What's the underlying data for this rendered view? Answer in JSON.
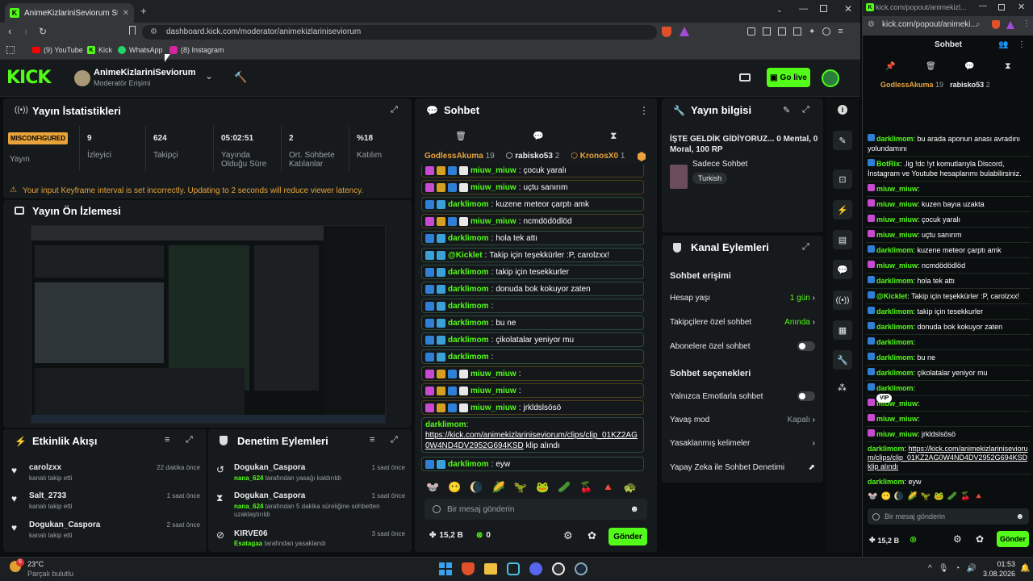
{
  "browser": {
    "tab_title": "AnimeKizlariniSeviorum Stream",
    "url": "dashboard.kick.com/moderator/animekizlariniseviorum",
    "bookmarks": [
      "(9) YouTube",
      "Kick",
      "WhatsApp",
      "(8) Instagram"
    ]
  },
  "header": {
    "channel": "AnimeKizlariniSeviorum",
    "role": "Moderatör Erişimi",
    "go_live": "Go live"
  },
  "stats": {
    "title": "Yayın İstatistikleri",
    "status": "MISCONFIGURED",
    "status_label": "Yayın",
    "items": [
      {
        "value": "9",
        "label": "İzleyici"
      },
      {
        "value": "624",
        "label": "Takipçi"
      },
      {
        "value": "05:02:51",
        "label": "Yayında Olduğu Süre"
      },
      {
        "value": "2",
        "label": "Ort. Sohbete Katılanlar"
      },
      {
        "value": "%18",
        "label": "Katılım"
      }
    ],
    "warning": "Your input Keyframe interval is set incorrectly. Updating to 2 seconds will reduce viewer latency."
  },
  "preview": {
    "title": "Yayın Ön İzlemesi"
  },
  "activity": {
    "title": "Etkinlik Akışı",
    "items": [
      {
        "user": "carolzxx",
        "desc": "kanalı takip etti",
        "time": "22 dakika önce"
      },
      {
        "user": "Salt_2733",
        "desc": "kanalı takip etti",
        "time": "1 saat önce"
      },
      {
        "user": "Dogukan_Caspora",
        "desc": "kanalı takip etti",
        "time": "2 saat önce"
      }
    ]
  },
  "moderation": {
    "title": "Denetim Eylemleri",
    "items": [
      {
        "user": "Dogukan_Caspora",
        "actor": "nana_624",
        "desc": "tarafından yasağı kaldırıldı",
        "time": "1 saat önce"
      },
      {
        "user": "Dogukan_Caspora",
        "actor": "nana_624",
        "desc": "tarafından 5 dakika süreliğine sohbetten uzaklaştırıldı",
        "time": "1 saat önce"
      },
      {
        "user": "KIRVE06",
        "actor": "Esatagaa",
        "desc": "tarafından yasaklandı",
        "time": "3 saat önce"
      }
    ]
  },
  "chat": {
    "title": "Sohbet",
    "placeholder": "Bir mesaj gönderin",
    "send": "Gönder",
    "kicks": "15,2 B",
    "points": "0",
    "gifters": [
      {
        "name": "GodlessAkuma",
        "count": "19"
      },
      {
        "name": "rabisko53",
        "count": "2"
      },
      {
        "name": "KronosX0",
        "count": "1"
      }
    ],
    "messages": [
      {
        "user": "miuw_miuw",
        "color": "#53fc18",
        "text": "çocuk yaralı",
        "badges": "s"
      },
      {
        "user": "miuw_miuw",
        "color": "#53fc18",
        "text": "uçtu sanırım",
        "badges": "s"
      },
      {
        "user": "darklimom",
        "color": "#53fc18",
        "text": "kuzene meteor çarptı amk",
        "badges": "m"
      },
      {
        "user": "miuw_miuw",
        "color": "#53fc18",
        "text": "ncmdödödlöd",
        "badges": "s"
      },
      {
        "user": "darklimom",
        "color": "#53fc18",
        "text": "hola tek attı",
        "badges": "m"
      },
      {
        "user": "@Kicklet",
        "color": "#53fc18",
        "text": "Takip için teşekkürler :P, carolzxx!",
        "badges": "b"
      },
      {
        "user": "darklimom",
        "color": "#53fc18",
        "text": "takip için tesekkurler",
        "badges": "m"
      },
      {
        "user": "darklimom",
        "color": "#53fc18",
        "text": "donuda bok kokuyor zaten",
        "badges": "m"
      },
      {
        "user": "darklimom",
        "color": "#53fc18",
        "text": "",
        "badges": "m"
      },
      {
        "user": "darklimom",
        "color": "#53fc18",
        "text": "bu ne",
        "badges": "m"
      },
      {
        "user": "darklimom",
        "color": "#53fc18",
        "text": "çikolatalar yeniyor mu",
        "badges": "m"
      },
      {
        "user": "darklimom",
        "color": "#53fc18",
        "text": "",
        "badges": "m"
      },
      {
        "user": "miuw_miuw",
        "color": "#53fc18",
        "text": "",
        "badges": "s"
      },
      {
        "user": "miuw_miuw",
        "color": "#53fc18",
        "text": "",
        "badges": "s"
      },
      {
        "user": "miuw_miuw",
        "color": "#53fc18",
        "text": "jrkldslsösö",
        "badges": "s"
      }
    ],
    "link_user": "darklimom",
    "link_url": "https://kick.com/animekizlariniseviorum/clips/clip_01KZ2AG0W4ND4DV2952G694KSD",
    "link_suffix": "klip alındı",
    "last": {
      "user": "darklimom",
      "text": "eyw"
    }
  },
  "info": {
    "title": "Yayın bilgisi",
    "stream_title": "İŞTE GELDİK GİDİYORUZ... 0 Mental, 0 Moral, 100 RP",
    "category": "Sadece Sohbet",
    "tag": "Turkish"
  },
  "actions": {
    "title": "Kanal Eylemleri",
    "chat_access": "Sohbet erişimi",
    "rows": [
      {
        "label": "Hesap yaşı",
        "value": "1 gün"
      },
      {
        "label": "Takipçilere özel sohbet",
        "value": "Anında"
      },
      {
        "label": "Abonelere özel sohbet",
        "value": ""
      }
    ],
    "chat_options": "Sohbet seçenekleri",
    "rows2": [
      {
        "label": "Yalnızca Emotlarla sohbet",
        "value": ""
      },
      {
        "label": "Yavaş mod",
        "value": "Kapalı"
      },
      {
        "label": "Yasaklanmış kelimeler",
        "value": ""
      },
      {
        "label": "Yapay Zeka ile Sohbet Denetimi",
        "value": ""
      }
    ]
  },
  "popout": {
    "url": "kick.com/popout/animeki...",
    "url_short": "kick.com/popout/animekizl...",
    "title": "Sohbet",
    "placeholder": "Bir mesaj gönderin",
    "send": "Gönder",
    "kicks": "15,2 B",
    "gifters": [
      {
        "name": "GodlessAkuma",
        "count": "19"
      },
      {
        "name": "rabisko53",
        "count": "2"
      }
    ],
    "messages": [
      {
        "user": "darklimom",
        "text": "bu arada aponun anası avradını yolundamını"
      },
      {
        "user": "BotRix",
        "text": ".lig !dc !yt komutlarıyla Discord, İnstagram ve Youtube hesaplarımı bulabilirsiniz."
      },
      {
        "user": "miuw_miuw",
        "text": ""
      },
      {
        "user": "miuw_miuw",
        "text": "kuzen bayıa uzakta"
      },
      {
        "user": "miuw_miuw",
        "text": "çocuk yaralı"
      },
      {
        "user": "miuw_miuw",
        "text": "uçtu sanırım"
      },
      {
        "user": "darklimom",
        "text": "kuzene meteor çarptı amk"
      },
      {
        "user": "miuw_miuw",
        "text": "ncmdödödlöd"
      },
      {
        "user": "darklimom",
        "text": "hola tek attı"
      },
      {
        "user": "@Kicklet",
        "text": "Takip için teşekkürler :P, carolzxx!"
      },
      {
        "user": "darklimom",
        "text": "takip için tesekkurler"
      },
      {
        "user": "darklimom",
        "text": "donuda bok kokuyor zaten"
      },
      {
        "user": "darklimom",
        "text": ""
      },
      {
        "user": "darklimom",
        "text": "bu ne"
      },
      {
        "user": "darklimom",
        "text": "çikolatalar yeniyor mu"
      },
      {
        "user": "darklimom",
        "text": ""
      },
      {
        "user": "miuw_miuw",
        "text": ""
      },
      {
        "user": "miuw_miuw",
        "text": ""
      },
      {
        "user": "miuw_miuw",
        "text": "jrkldslsösö"
      }
    ],
    "link_text": "https://kick.com/animekizlariniseviorum/clips/clip_01KZ2AG0W4ND4DV2952G694KSD klip alındı",
    "last": {
      "user": "darklimom",
      "text": "eyw"
    },
    "vip": "VIP"
  },
  "taskbar": {
    "temp": "23°C",
    "weather": "Parçalı bulutlu",
    "time": "01:53",
    "date": "3.08.2026",
    "notif": "6"
  }
}
